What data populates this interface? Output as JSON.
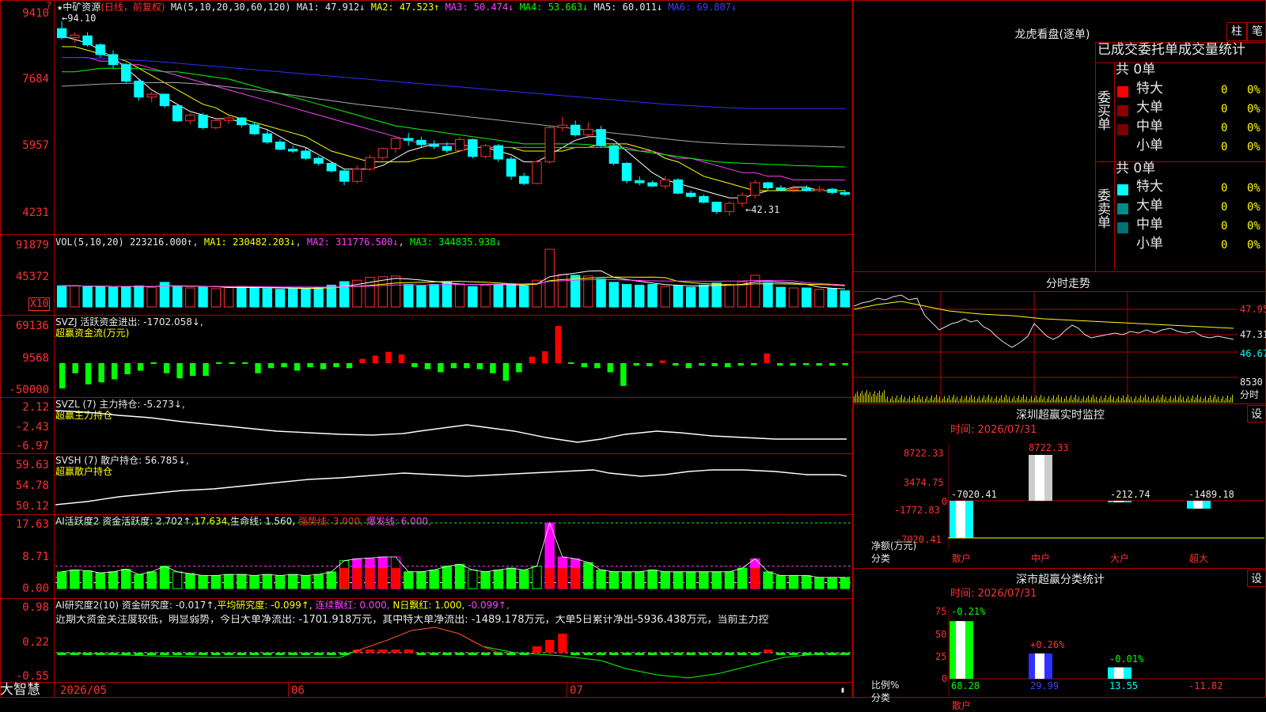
{
  "stock": {
    "name": "中矿资源",
    "period": "(日线，前复权)",
    "ma_label": "MA(5,10,20,30,60,120)",
    "ma_values": [
      {
        "label": "MA1:",
        "value": "47.912↓",
        "color": "#e8e8e8"
      },
      {
        "label": "MA2:",
        "value": "47.523↑",
        "color": "#ffff00"
      },
      {
        "label": "MA3:",
        "value": "50.474↓",
        "color": "#ff40ff"
      },
      {
        "label": "MA4:",
        "value": "53.663↓",
        "color": "#00ff00"
      },
      {
        "label": "MA5:",
        "value": "60.011↓",
        "color": "#e8e8e8"
      },
      {
        "label": "MA6:",
        "value": "69.807↓",
        "color": "#4040ff"
      }
    ],
    "high_mark": "94.10",
    "low_mark": "42.31",
    "price_ticks": [
      "9410",
      "7684",
      "5957",
      "4231"
    ]
  },
  "vol": {
    "label": "VOL(5,10,20)",
    "value": "223216.000↑",
    "ma1": "MA1: 230482.203↓",
    "ma2": "MA2: 311776.500↓",
    "ma3": "MA3: 344835.938↓",
    "ticks": [
      "91879",
      "45372"
    ],
    "unit": "X10"
  },
  "svzj": {
    "label": "SVZJ  活跃资金进出: -1702.058↓,",
    "sub": "超赢资金流(万元)",
    "ticks": [
      "69136",
      "9568",
      "-50000"
    ]
  },
  "svzl": {
    "label": "SVZL (7) 主力持仓: -5.273↓,",
    "sub": "超赢主力持仓",
    "ticks": [
      "2.12",
      "-2.43",
      "-6.97"
    ]
  },
  "svsh": {
    "label": "SVSH (7) 散户持仓: 56.785↓,",
    "sub": "超赢散户持仓",
    "ticks": [
      "59.63",
      "54.78",
      "50.12"
    ]
  },
  "ai1": {
    "label": "AI活跃度2 资金活跃度: 2.702↑,",
    "v2": "17.634,",
    "v3": "生命线: 1.560,",
    "v4": "强势线: 3.000,",
    "v5": "爆发线: 6.000,",
    "ticks": [
      "17.63",
      "8.71",
      "0.00"
    ]
  },
  "ai2": {
    "label": "AI研究度2(10) 资金研究度: -0.017↑,",
    "v2": "平均研究度: -0.099↑,",
    "v3": "连续飘红: 0.000,",
    "v4": "N日飘红: 1.000,",
    "v5": "-0.099↑,",
    "text": "近期大资金关注度较低，明显弱势，今日大单净流出: -1701.918万元，其中特大单净流出: -1489.178万元，大单5日累计净出-5936.438万元，当前主力控",
    "ticks": [
      "0.98",
      "0.22",
      "-0.55"
    ]
  },
  "footer": {
    "brand": "大智慧",
    "dates": [
      "2026/05",
      "06",
      "07"
    ]
  },
  "right": {
    "lhkp": "龙虎看盘(逐单)",
    "btn1": "柱",
    "btn2": "笔",
    "header": "已成交委托单成交量统计",
    "buy_side": "委买单",
    "sell_side": "委卖单",
    "total": "共 0单",
    "rows": [
      {
        "name": "特大",
        "v": "0",
        "p": "0%"
      },
      {
        "name": "大单",
        "v": "0",
        "p": "0%"
      },
      {
        "name": "中单",
        "v": "0",
        "p": "0%"
      },
      {
        "name": "小单",
        "v": "0",
        "p": "0%"
      }
    ],
    "buy_colors": [
      "#ff0000",
      "#8b0000",
      "#7a0000",
      ""
    ],
    "sell_colors": [
      "#00ffff",
      "#008b8b",
      "#007070",
      ""
    ],
    "fenshi": "分时走势",
    "fs_ticks": [
      "47.95",
      "47.31",
      "46.67",
      "8530"
    ],
    "fs_unit": "分时",
    "sz_title": "深圳超赢实时监控",
    "set": "设",
    "time": "时间: 2026/07/31",
    "sz_ticks": [
      "8722.33",
      "3474.75",
      "0",
      "-1772.83",
      "-7020.41"
    ],
    "sz_ylabel": "净额(万元)",
    "sz_xlabel": "分类",
    "sz_vals": [
      "-7020.41",
      "8722.33",
      "-212.74",
      "-1489.18"
    ],
    "cats": [
      "散户",
      "中户",
      "大户",
      "超大"
    ],
    "fl_title": "深市超赢分类统计",
    "fl_ticks": [
      "75",
      "50",
      "25",
      "0"
    ],
    "fl_ylabel": "比例%",
    "fl_xlabel": "分类",
    "fl_pcts": [
      "-0.21%",
      "+0.26%",
      "-0.01%"
    ],
    "fl_vals": [
      "68.28",
      "29.99",
      "13.55",
      "-11.82"
    ]
  },
  "chart_data": [
    {
      "type": "candlestick",
      "title": "中矿资源",
      "ylim": [
        42.31,
        94.1
      ],
      "ohlc": [
        [
          92,
          94.1,
          89,
          89.5
        ],
        [
          89.5,
          91,
          88,
          90.2
        ],
        [
          90,
          91,
          87,
          87.5
        ],
        [
          87.5,
          88,
          84,
          84.8
        ],
        [
          84.8,
          86,
          81,
          82
        ],
        [
          82,
          82.5,
          77,
          77.4
        ],
        [
          77.4,
          78,
          72,
          73
        ],
        [
          73,
          74.5,
          71.5,
          73.8
        ],
        [
          73.8,
          74,
          70,
          70.6
        ],
        [
          70.6,
          71,
          66,
          66.4
        ],
        [
          66.4,
          68.5,
          65.5,
          68
        ],
        [
          68,
          68.6,
          64,
          64.5
        ],
        [
          64.5,
          67,
          64,
          66.5
        ],
        [
          66.5,
          68,
          65.5,
          67.2
        ],
        [
          67.2,
          67.5,
          64.5,
          65.3
        ],
        [
          65.3,
          66,
          62.5,
          62.8
        ],
        [
          62.8,
          64,
          60,
          60.5
        ],
        [
          60.5,
          61.2,
          58.2,
          58.5
        ],
        [
          58.5,
          59.5,
          57.5,
          58
        ],
        [
          58,
          58.8,
          55.5,
          56
        ],
        [
          56,
          56.5,
          54,
          54.6
        ],
        [
          54.6,
          55,
          52,
          52.5
        ],
        [
          52.5,
          53,
          48.5,
          49.6
        ],
        [
          49.6,
          54,
          49,
          53
        ],
        [
          53,
          57,
          52.5,
          56.2
        ],
        [
          56.2,
          59,
          55.5,
          58.7
        ],
        [
          58.7,
          62,
          57.5,
          61.5
        ],
        [
          61.5,
          63,
          59.5,
          61
        ],
        [
          61,
          62,
          59,
          59.8
        ],
        [
          59.8,
          61,
          58.5,
          59.3
        ],
        [
          59.3,
          60.5,
          57.5,
          58.2
        ],
        [
          58.2,
          62,
          57.8,
          61.2
        ],
        [
          61.2,
          61.5,
          56,
          56.5
        ],
        [
          56.5,
          60,
          56,
          59.5
        ],
        [
          59.5,
          60,
          55,
          55.8
        ],
        [
          55.8,
          56.5,
          50,
          51
        ],
        [
          51,
          52,
          48.5,
          49
        ],
        [
          49,
          55.5,
          48.8,
          55
        ],
        [
          55,
          65,
          54.5,
          64.5
        ],
        [
          64.5,
          67.5,
          63.5,
          65.2
        ],
        [
          65.2,
          66.5,
          62,
          62.5
        ],
        [
          62.5,
          66,
          61.5,
          64
        ],
        [
          64,
          65,
          59,
          59.5
        ],
        [
          59.5,
          60,
          54,
          54.6
        ],
        [
          54.6,
          55,
          49,
          49.8
        ],
        [
          49.8,
          51,
          48.5,
          49.2
        ],
        [
          49.2,
          49.8,
          48,
          48.3
        ],
        [
          48.3,
          51,
          47.5,
          50
        ],
        [
          50,
          50.5,
          46,
          46.3
        ],
        [
          46.3,
          47,
          45,
          45.4
        ],
        [
          45.4,
          46,
          43.5,
          43.8
        ],
        [
          43.8,
          44,
          40.5,
          41.2
        ],
        [
          41.2,
          44,
          40,
          43.5
        ],
        [
          43.5,
          46.5,
          42.5,
          45.7
        ],
        [
          45.7,
          50,
          45,
          49.2
        ],
        [
          49.2,
          49.5,
          47.2,
          47.8
        ],
        [
          47.8,
          48.5,
          46.8,
          47.2
        ],
        [
          47.2,
          48.5,
          46.5,
          47.6
        ],
        [
          47.6,
          48.5,
          46.8,
          47
        ],
        [
          47,
          48.3,
          46.5,
          47.4
        ],
        [
          47.4,
          47.8,
          46,
          46.5
        ],
        [
          46.5,
          47.2,
          45.5,
          46
        ]
      ],
      "ma5": [
        90,
        89,
        88,
        86,
        84,
        81,
        78,
        75,
        73,
        71,
        69,
        68,
        67,
        67,
        66,
        65,
        64,
        62,
        60,
        59,
        57,
        55,
        53,
        53,
        53,
        54,
        56,
        58,
        59,
        60,
        60,
        60,
        59,
        59,
        58,
        57,
        55,
        55,
        57,
        59,
        61,
        62,
        62,
        61,
        58,
        55,
        52,
        50,
        49,
        48,
        47,
        46,
        45,
        45,
        46,
        47,
        47,
        48,
        48,
        47,
        47,
        47
      ],
      "ma10": [
        87,
        87,
        86,
        85,
        84,
        83,
        81,
        79,
        77,
        75,
        73,
        71,
        70,
        68,
        67,
        66,
        65,
        64,
        63,
        62,
        60,
        58,
        57,
        56,
        55,
        55,
        55,
        55,
        56,
        56,
        57,
        58,
        59,
        59,
        59,
        59,
        58,
        58,
        58,
        58,
        59,
        59,
        60,
        60,
        60,
        59,
        58,
        56,
        55,
        53,
        51,
        50,
        49,
        48,
        47,
        47,
        47,
        47,
        47,
        47,
        47,
        47
      ],
      "ma20": [
        84,
        84,
        84,
        83,
        83,
        82,
        82,
        81,
        80,
        79,
        78,
        77,
        76,
        75,
        74,
        73,
        72,
        71,
        70,
        69,
        68,
        67,
        66,
        65,
        64,
        63,
        62,
        61,
        60,
        60,
        60,
        60,
        59,
        59,
        59,
        59,
        59,
        59,
        59,
        59,
        59,
        59,
        59,
        59,
        59,
        58,
        58,
        57,
        56,
        56,
        55,
        54,
        53,
        52,
        52,
        51,
        51,
        50,
        50,
        50,
        50,
        50
      ],
      "ma30": [
        80,
        80,
        80.5,
        81,
        81,
        81,
        81,
        80.5,
        80,
        80,
        79.5,
        79,
        78.5,
        78,
        77,
        76,
        75,
        74,
        73,
        72,
        71,
        70,
        69,
        68,
        67,
        66,
        65,
        64.5,
        64,
        63.5,
        63,
        62.5,
        62,
        61.5,
        61,
        60.5,
        60,
        60,
        60,
        60,
        60,
        59.8,
        59.5,
        59,
        58.5,
        58,
        57.5,
        57,
        56.5,
        56,
        55.5,
        55,
        54.8,
        54.6,
        54.5,
        54.3,
        54.2,
        54,
        53.9,
        53.8,
        53.7,
        53.6
      ],
      "ma60": [
        76,
        76.2,
        76.4,
        76.6,
        76.7,
        76.8,
        76.9,
        77,
        77,
        77,
        76.8,
        76.5,
        76.2,
        75.8,
        75.4,
        75,
        74.5,
        74,
        73.5,
        73,
        72.5,
        72,
        71.5,
        71,
        70.6,
        70.2,
        69.8,
        69.4,
        69,
        68.6,
        68.2,
        67.8,
        67.4,
        67,
        66.6,
        66.2,
        65.8,
        65.4,
        65,
        64.6,
        64.2,
        63.8,
        63.4,
        63,
        62.6,
        62.2,
        61.8,
        61.4,
        61,
        60.7,
        60.4,
        60.2,
        60,
        59.9,
        59.8,
        59.7,
        59.6,
        59.5,
        59.4,
        59.3,
        59.2,
        59.1
      ],
      "ma120": [
        84,
        84,
        83.9,
        83.8,
        83.6,
        83.4,
        83.2,
        83,
        82.7,
        82.4,
        82.1,
        81.8,
        81.5,
        81.2,
        80.9,
        80.6,
        80.3,
        80,
        79.7,
        79.4,
        79.1,
        78.8,
        78.5,
        78.2,
        77.9,
        77.6,
        77.3,
        77,
        76.7,
        76.4,
        76.1,
        75.8,
        75.5,
        75.2,
        74.9,
        74.6,
        74.3,
        74,
        73.7,
        73.4,
        73.1,
        72.8,
        72.5,
        72.2,
        71.9,
        71.6,
        71.3,
        71,
        70.8,
        70.6,
        70.4,
        70.2,
        70,
        69.9,
        69.8,
        69.8,
        69.8,
        69.8,
        69.8,
        69.8,
        69.8,
        69.8
      ]
    },
    {
      "type": "bar",
      "title": "VOL",
      "values": [
        30,
        30,
        29,
        29,
        28,
        29,
        30,
        28,
        35,
        29,
        27,
        28,
        26,
        28,
        29,
        27,
        26,
        25,
        27,
        26,
        28,
        31,
        36,
        38,
        42,
        43,
        44,
        32,
        30,
        32,
        35,
        33,
        29,
        31,
        32,
        33,
        30,
        38,
        82,
        46,
        45,
        44,
        40,
        35,
        32,
        31,
        32,
        29,
        30,
        28,
        31,
        34,
        32,
        36,
        45,
        34,
        28,
        27,
        27,
        25,
        26,
        23
      ]
    },
    {
      "type": "bar",
      "title": "超赢资金流(万元)",
      "values": [
        -50000,
        -20000,
        -42000,
        -38000,
        -32000,
        -22000,
        -15000,
        0,
        -20000,
        -30000,
        -25000,
        -25000,
        0,
        0,
        0,
        -20000,
        -10000,
        -8000,
        -15000,
        -8000,
        -12000,
        -8000,
        -10000,
        8000,
        14000,
        21000,
        16000,
        -8000,
        -12000,
        -18000,
        -10000,
        -10000,
        -12000,
        -20000,
        -35000,
        -18000,
        12000,
        22000,
        69136,
        0,
        -8000,
        -10000,
        -18000,
        -45000,
        -5000,
        -6000,
        5000,
        -5000,
        -10000,
        -5000,
        -6000,
        -8000,
        -5000,
        -4000,
        18000,
        -5000,
        -5000,
        -4000,
        -5000,
        -5000,
        -4000
      ]
    },
    {
      "type": "bar",
      "title": "AI活跃度2",
      "values": [
        4.5,
        5,
        4.8,
        4.2,
        4.5,
        5.2,
        3.8,
        4.5,
        6,
        4.5,
        4,
        3.5,
        3.5,
        3.8,
        3.8,
        3.5,
        3.8,
        3.5,
        3.8,
        3.5,
        3.8,
        4.5,
        7.5,
        8,
        8.2,
        8.5,
        8.5,
        4.5,
        4.5,
        5,
        6,
        6.5,
        5,
        4.5,
        5,
        5.5,
        5,
        6,
        17.63,
        8.5,
        8,
        7,
        5,
        4.5,
        4.5,
        4.5,
        5,
        4.5,
        4.5,
        4.5,
        4.5,
        4.5,
        4.5,
        5.5,
        8,
        4.5,
        3.5,
        3.5,
        3.5,
        3,
        3,
        3
      ]
    }
  ]
}
